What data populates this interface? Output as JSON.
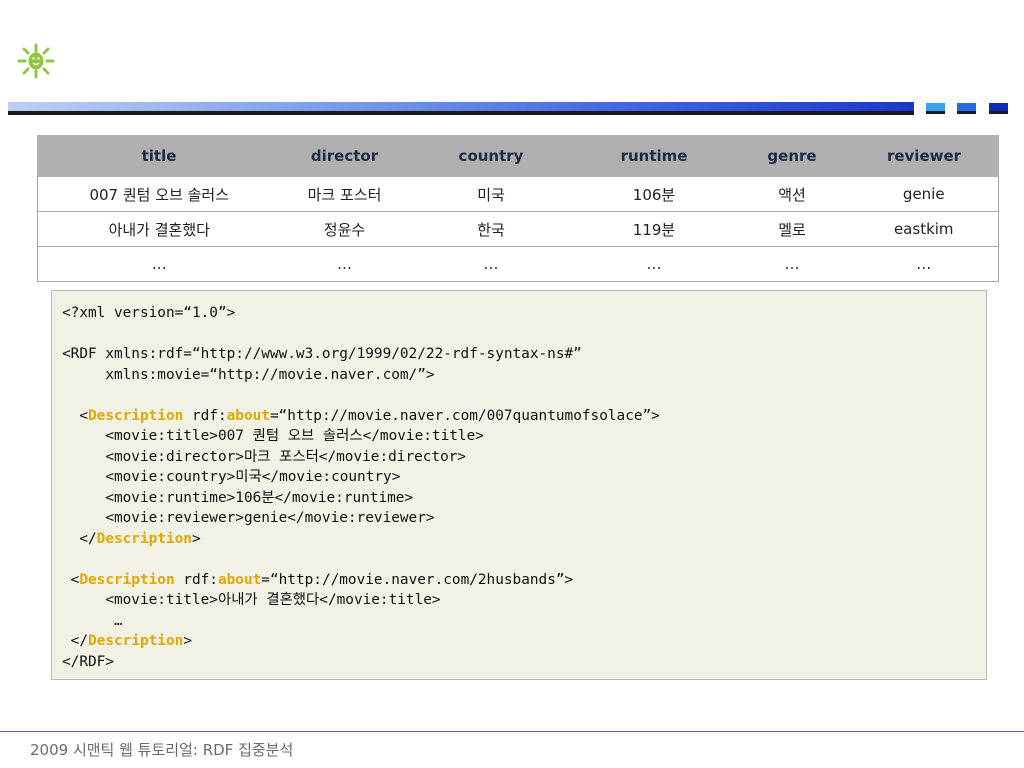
{
  "logo": {
    "icon": "sun-face-icon",
    "color": "#8ec63f"
  },
  "table": {
    "headers": [
      "title",
      "director",
      "country",
      "runtime",
      "genre",
      "reviewer"
    ],
    "rows": [
      [
        "007 퀀텀 오브 솔러스",
        "마크 포스터",
        "미국",
        "106분",
        "액션",
        "genie"
      ],
      [
        "아내가 결혼했다",
        "정윤수",
        "한국",
        "119분",
        "멜로",
        "eastkim"
      ],
      [
        "…",
        "…",
        "…",
        "…",
        "…",
        "…"
      ]
    ]
  },
  "code": {
    "line1": "<?xml version=“1.0”>",
    "line2": "<RDF xmlns:rdf=“http://www.w3.org/1999/02/22-rdf-syntax-ns#”",
    "line3": "     xmlns:movie=“http://movie.naver.com/”>",
    "d1_open_prefix": "  <",
    "description_kw": "Description",
    "rdf_prefix": " rdf:",
    "about_kw": "about",
    "d1_about_value": "=“http://movie.naver.com/007quantumofsolace”>",
    "d1_title": "     <movie:title>007 퀀텀 오브 솔러스</movie:title>",
    "d1_director": "     <movie:director>마크 포스터</movie:director>",
    "d1_country": "     <movie:country>미국</movie:country>",
    "d1_runtime": "     <movie:runtime>106분</movie:runtime>",
    "d1_reviewer": "     <movie:reviewer>genie</movie:reviewer>",
    "d1_close_prefix": "  </",
    "close_suffix": ">",
    "d2_open_prefix": " <",
    "d2_about_value": "=“http://movie.naver.com/2husbands”>",
    "d2_title": "     <movie:title>아내가 결혼했다</movie:title>",
    "d2_ellipsis": "      …",
    "d2_close_prefix": " </",
    "rdf_close": "</RDF>"
  },
  "colors": {
    "keyword": "#e0a800",
    "header_bg": "#b0b0b0",
    "code_bg": "#f1f1e6"
  },
  "footer": {
    "text": "2009 시맨틱 웹 튜토리얼: RDF 집중분석"
  }
}
